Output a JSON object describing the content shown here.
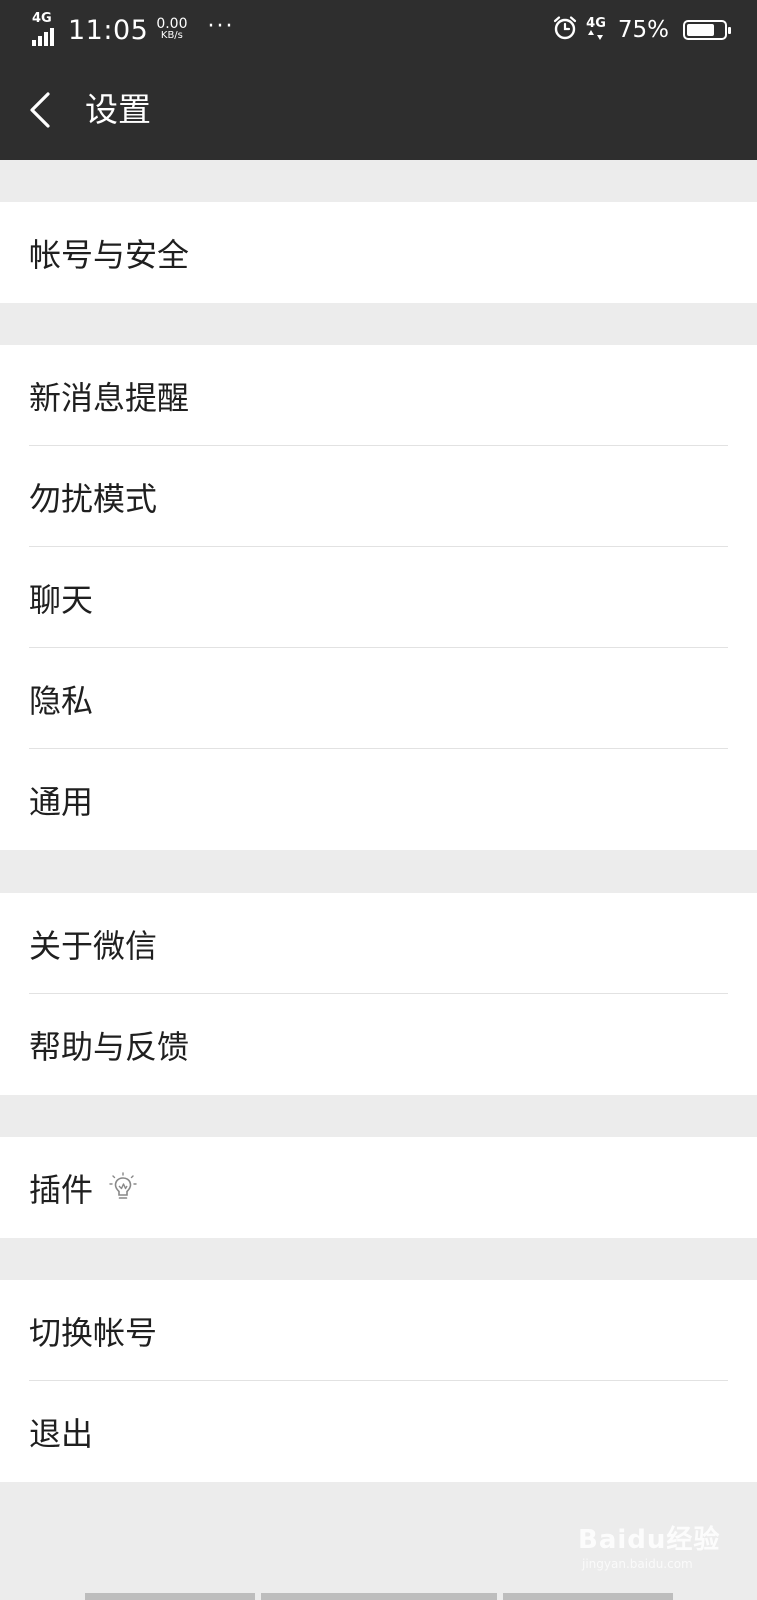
{
  "status_bar": {
    "network": "4G",
    "time": "11:05",
    "speed_value": "0.00",
    "speed_unit": "KB/s",
    "more": "···",
    "network_right": "4G",
    "battery_percent": "75%",
    "battery_level": 0.75
  },
  "header": {
    "title": "设置"
  },
  "groups": [
    {
      "items": [
        {
          "label": "帐号与安全"
        }
      ]
    },
    {
      "items": [
        {
          "label": "新消息提醒"
        },
        {
          "label": "勿扰模式"
        },
        {
          "label": "聊天"
        },
        {
          "label": "隐私"
        },
        {
          "label": "通用"
        }
      ]
    },
    {
      "items": [
        {
          "label": "关于微信"
        },
        {
          "label": "帮助与反馈"
        }
      ]
    },
    {
      "items": [
        {
          "label": "插件",
          "icon": "bulb-icon"
        }
      ]
    },
    {
      "items": [
        {
          "label": "切换帐号"
        },
        {
          "label": "退出"
        }
      ]
    }
  ],
  "watermark": {
    "logo_text": "Baidu经验",
    "url": "jingyan.baidu.com"
  },
  "colors": {
    "header_bg": "#2e2e2e",
    "page_bg": "#ececec",
    "row_bg": "#ffffff",
    "divider": "#e2e2e2",
    "text": "#1f1f1f"
  }
}
